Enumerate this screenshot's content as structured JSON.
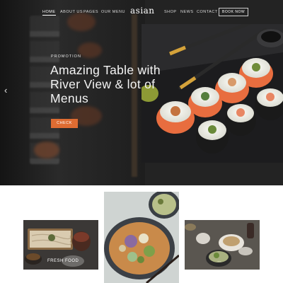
{
  "nav": {
    "left": [
      "HOME",
      "ABOUT US",
      "PAGES",
      "OUR MENU"
    ],
    "logo": "asian",
    "right": [
      "SHOP",
      "NEWS",
      "CONTACT"
    ],
    "book_label": "BOOK NOW",
    "active": "HOME"
  },
  "hero": {
    "promo_label": "PROMOTION",
    "headline": "Amazing Table with River View & lot of Menus",
    "cta_label": "CHECK",
    "slides": 2,
    "active_slide": 1,
    "arrow": "chevron-left-icon"
  },
  "gallery": {
    "cards": [
      {
        "caption": "FRESH FOOD"
      },
      {
        "caption": ""
      },
      {
        "caption": "…"
      }
    ]
  },
  "colors": {
    "accent": "#de6c32",
    "hero_bg": "#232323"
  }
}
